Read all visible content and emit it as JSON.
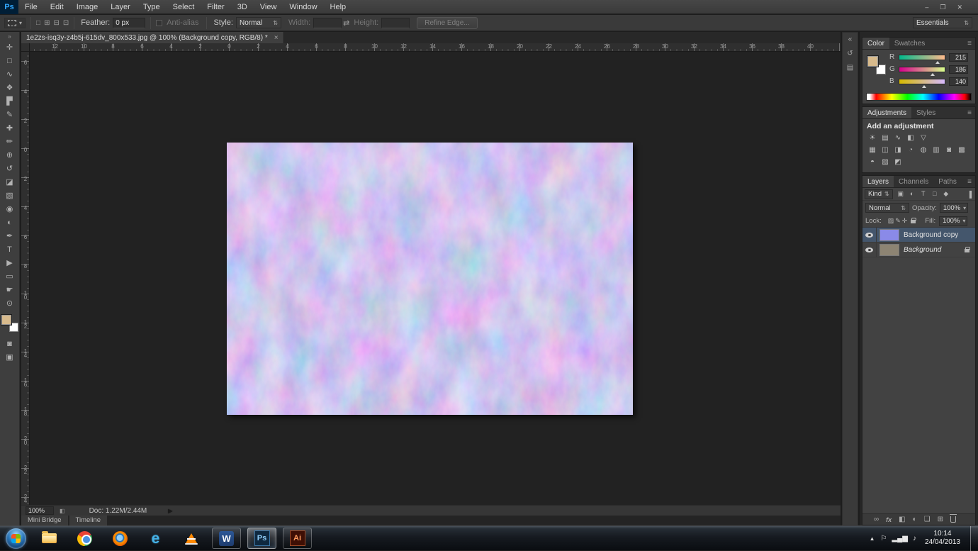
{
  "colors": {
    "foreground_swatch": "#d7ba8c",
    "background_swatch": "#ffffff",
    "selected_layer": "#44566c",
    "thumb_normalmap": "#8a8ae8",
    "thumb_texture": "#8d8473",
    "accent_blue": "#31a8ff"
  },
  "menubar": {
    "logo": "Ps",
    "items": [
      "File",
      "Edit",
      "Image",
      "Layer",
      "Type",
      "Select",
      "Filter",
      "3D",
      "View",
      "Window",
      "Help"
    ]
  },
  "window_controls": {
    "minimize": "‒",
    "maximize": "❐",
    "close": "✕"
  },
  "options_bar": {
    "combine_icons": [
      {
        "name": "new-selection-icon",
        "glyph": "□"
      },
      {
        "name": "add-selection-icon",
        "glyph": "⊞"
      },
      {
        "name": "subtract-selection-icon",
        "glyph": "⊟"
      },
      {
        "name": "intersect-selection-icon",
        "glyph": "⊡"
      }
    ],
    "feather_label": "Feather:",
    "feather_value": "0 px",
    "antialias_label": "Anti-alias",
    "style_label": "Style:",
    "style_value": "Normal",
    "width_label": "Width:",
    "swap_icon": "⇄",
    "height_label": "Height:",
    "refine_edge_label": "Refine Edge...",
    "workspace_label": "Essentials",
    "combo_arrow": "⇅",
    "dropdown_arrow": "▾"
  },
  "document_tab": {
    "title": "1e2zs-isq3y-z4b5j-615dv_800x533.jpg @ 100% (Background copy, RGB/8) *",
    "close_icon": "×"
  },
  "rulers": {
    "horizontal": [
      "12",
      "10",
      "8",
      "6",
      "4",
      "2",
      "0",
      "2",
      "4",
      "6",
      "8",
      "10",
      "12",
      "14",
      "16",
      "18",
      "20",
      "22",
      "24",
      "26",
      "28",
      "30",
      "32",
      "34",
      "36",
      "38",
      "40"
    ],
    "vertical": [
      "6",
      "4",
      "2",
      "0",
      "2",
      "4",
      "6",
      "8",
      "10",
      "12",
      "14",
      "16",
      "18",
      "20",
      "22",
      "24"
    ]
  },
  "toolbar": {
    "collapse_icon": "»",
    "tools": [
      {
        "name": "move-tool",
        "glyph": "✛"
      },
      {
        "name": "rectangular-marquee-tool",
        "glyph": "□"
      },
      {
        "name": "lasso-tool",
        "glyph": "∿"
      },
      {
        "name": "quick-selection-tool",
        "glyph": "❖"
      },
      {
        "name": "crop-tool",
        "glyph": "▛"
      },
      {
        "name": "eyedropper-tool",
        "glyph": "✎"
      },
      {
        "name": "spot-healing-brush-tool",
        "glyph": "✚"
      },
      {
        "name": "brush-tool",
        "glyph": "✏"
      },
      {
        "name": "clone-stamp-tool",
        "glyph": "⊕"
      },
      {
        "name": "history-brush-tool",
        "glyph": "↺"
      },
      {
        "name": "eraser-tool",
        "glyph": "◪"
      },
      {
        "name": "gradient-tool",
        "glyph": "▧"
      },
      {
        "name": "blur-tool",
        "glyph": "◉"
      },
      {
        "name": "dodge-tool",
        "glyph": "◐"
      },
      {
        "name": "pen-tool",
        "glyph": "✒"
      },
      {
        "name": "type-tool",
        "glyph": "T"
      },
      {
        "name": "path-selection-tool",
        "glyph": "▶"
      },
      {
        "name": "shape-tool",
        "glyph": "▭"
      },
      {
        "name": "hand-tool",
        "glyph": "☛"
      },
      {
        "name": "zoom-tool",
        "glyph": "⊙"
      }
    ],
    "extras": [
      {
        "name": "quick-mask-icon",
        "glyph": "◙"
      },
      {
        "name": "screen-mode-icon",
        "glyph": "▣"
      }
    ]
  },
  "dock_strip": {
    "icons": [
      {
        "name": "expand-dock-icon",
        "glyph": "«"
      },
      {
        "name": "history-panel-icon",
        "glyph": "↺"
      },
      {
        "name": "properties-panel-icon",
        "glyph": "▤"
      }
    ]
  },
  "panels": {
    "color": {
      "tabs": [
        "Color",
        "Swatches"
      ],
      "menu_icon": "≡",
      "channels": [
        {
          "label": "R",
          "value": "215",
          "grad": "linear-gradient(90deg,#00ba8c,#ffba8c)",
          "pos": "84%"
        },
        {
          "label": "G",
          "value": "186",
          "grad": "linear-gradient(90deg,#d7008c,#d7ff8c)",
          "pos": "73%"
        },
        {
          "label": "B",
          "value": "140",
          "grad": "linear-gradient(90deg,#d7ba00,#d7baff)",
          "pos": "55%"
        }
      ]
    },
    "adjustments": {
      "tabs": [
        "Adjustments",
        "Styles"
      ],
      "menu_icon": "≡",
      "title": "Add an adjustment",
      "rows": [
        [
          {
            "name": "brightness-contrast-icon",
            "glyph": "☀"
          },
          {
            "name": "levels-icon",
            "glyph": "▤"
          },
          {
            "name": "curves-icon",
            "glyph": "∿"
          },
          {
            "name": "exposure-icon",
            "glyph": "◧"
          },
          {
            "name": "vibrance-icon",
            "glyph": "▽"
          }
        ],
        [
          {
            "name": "hue-saturation-icon",
            "glyph": "▦"
          },
          {
            "name": "color-balance-icon",
            "glyph": "◫"
          },
          {
            "name": "black-white-icon",
            "glyph": "◨"
          },
          {
            "name": "photo-filter-icon",
            "glyph": "◔"
          },
          {
            "name": "channel-mixer-icon",
            "glyph": "◍"
          },
          {
            "name": "color-lookup-icon",
            "glyph": "▥"
          },
          {
            "name": "invert-icon",
            "glyph": "◙"
          },
          {
            "name": "posterize-icon",
            "glyph": "▩"
          }
        ],
        [
          {
            "name": "threshold-icon",
            "glyph": "◓"
          },
          {
            "name": "gradient-map-icon",
            "glyph": "▨"
          },
          {
            "name": "selective-color-icon",
            "glyph": "◩"
          }
        ]
      ]
    },
    "layers": {
      "tabs": [
        "Layers",
        "Channels",
        "Paths"
      ],
      "menu_icon": "≡",
      "filter_label": "Kind",
      "filter_icons": [
        {
          "name": "filter-pixel-layers-icon",
          "glyph": "▣"
        },
        {
          "name": "filter-adjustment-layers-icon",
          "glyph": "◐"
        },
        {
          "name": "filter-type-layers-icon",
          "glyph": "T"
        },
        {
          "name": "filter-shape-layers-icon",
          "glyph": "□"
        },
        {
          "name": "filter-smart-object-icon",
          "glyph": "◆"
        }
      ],
      "filter_toggle": "▐",
      "blend_mode": "Normal",
      "opacity_label": "Opacity:",
      "opacity_value": "100%",
      "lock_label": "Lock:",
      "lock_icons": [
        {
          "name": "lock-transparency-icon",
          "glyph": "▨"
        },
        {
          "name": "lock-pixels-icon",
          "glyph": "✎"
        },
        {
          "name": "lock-position-icon",
          "glyph": "✛"
        }
      ],
      "fill_label": "Fill:",
      "fill_value": "100%",
      "rows": [
        {
          "name": "Background copy"
        },
        {
          "name": "Background"
        }
      ],
      "bottom": {
        "link": "∞",
        "fx": "fx",
        "mask": "◧",
        "adjust": "◐",
        "group": "❏",
        "new": "⊞"
      }
    }
  },
  "status_bar": {
    "zoom": "100%",
    "doc": "Doc: 1.22M/2.44M",
    "arrow": "▶"
  },
  "bottom_tabs": [
    "Mini Bridge",
    "Timeline"
  ],
  "taskbar": {
    "ie_label": "e",
    "word_label": "W",
    "ps_label": "Ps",
    "ai_label": "Ai",
    "tray_expand": "▲",
    "tray_icons": [
      {
        "name": "action-center-icon",
        "glyph": "⚐"
      },
      {
        "name": "network-icon",
        "glyph": "▂▄▆"
      },
      {
        "name": "volume-icon",
        "glyph": "♪"
      }
    ],
    "time": "10:14",
    "date": "24/04/2013"
  }
}
